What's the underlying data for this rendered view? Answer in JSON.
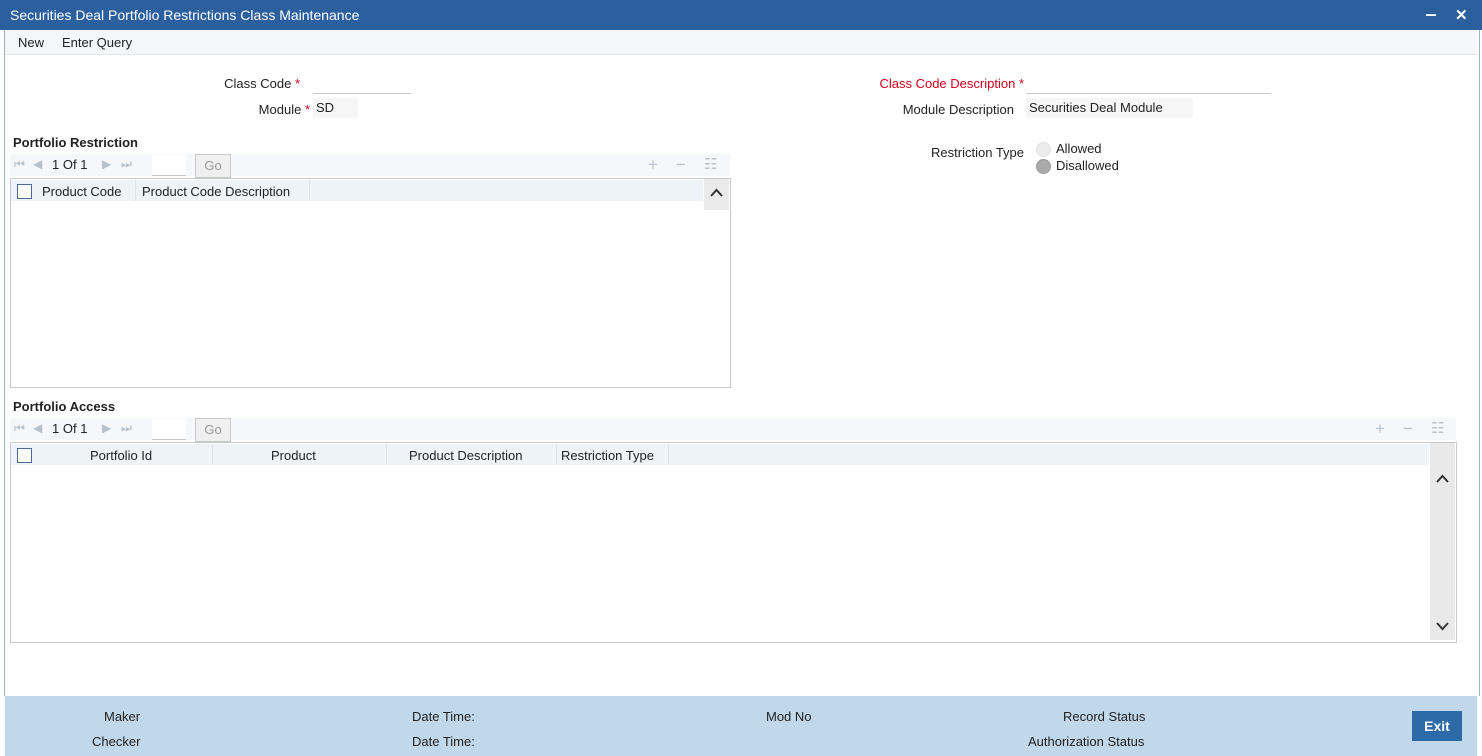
{
  "window": {
    "title": "Securities Deal Portfolio Restrictions Class Maintenance",
    "minimize_glyph": "‒",
    "close_glyph": "✕"
  },
  "menu": {
    "items": [
      "New",
      "Enter Query"
    ]
  },
  "form": {
    "class_code": {
      "label": "Class Code",
      "required": "*",
      "value": ""
    },
    "module": {
      "label": "Module",
      "required": "*",
      "value": "SD"
    },
    "class_code_description": {
      "label": "Class Code Description",
      "required": "*",
      "value": ""
    },
    "module_description": {
      "label": "Module Description",
      "value": "Securities Deal Module"
    },
    "restriction_type": {
      "label": "Restriction Type",
      "options": [
        "Allowed",
        "Disallowed"
      ],
      "selected": "Disallowed"
    }
  },
  "portfolio_restriction": {
    "title": "Portfolio Restriction",
    "pager": {
      "current": "1",
      "of_label": "Of",
      "total": "1",
      "go_label": "Go"
    },
    "columns": [
      "Product Code",
      "Product Code Description"
    ],
    "rows": []
  },
  "portfolio_access": {
    "title": "Portfolio Access",
    "pager": {
      "current": "1",
      "of_label": "Of",
      "total": "1",
      "go_label": "Go"
    },
    "columns": [
      "Portfolio Id",
      "Product",
      "Product Description",
      "Restriction Type"
    ],
    "rows": []
  },
  "footer": {
    "maker": "Maker",
    "checker": "Checker",
    "date_time_1": "Date Time:",
    "date_time_2": "Date Time:",
    "mod_no": "Mod No",
    "record_status": "Record Status",
    "authorization_status": "Authorization Status",
    "exit_label": "Exit"
  },
  "colors": {
    "titlebar": "#2b5f9e",
    "required": "#d3001c",
    "footer": "#c1d7ea",
    "exit_button": "#2c6aa8"
  },
  "icons": [
    "first-page-icon",
    "prev-page-icon",
    "next-page-icon",
    "last-page-icon",
    "add-row-icon",
    "delete-row-icon",
    "single-view-icon",
    "scroll-up-icon",
    "scroll-down-icon"
  ]
}
